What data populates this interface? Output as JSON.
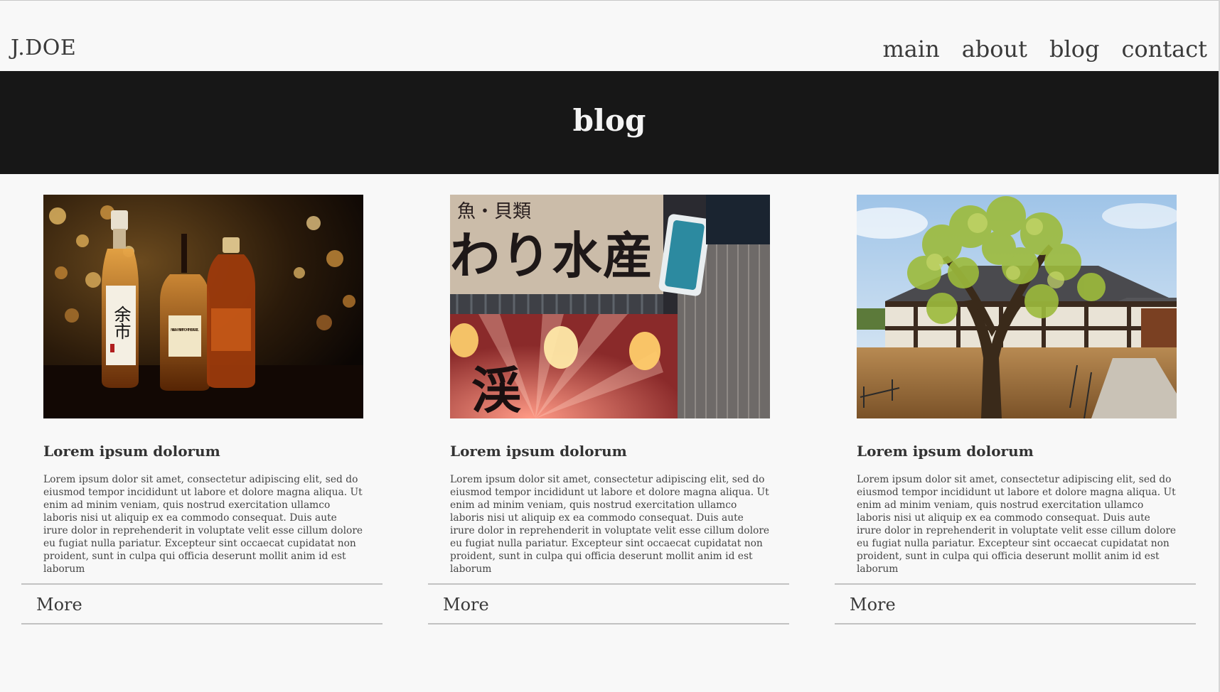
{
  "site": {
    "logo": "J.DOE"
  },
  "nav": {
    "items": [
      "main",
      "about",
      "blog",
      "contact"
    ]
  },
  "banner": {
    "title": "blog"
  },
  "posts": [
    {
      "title": "Lorem ipsum dolorum",
      "body": "Lorem ipsum dolor sit amet, consectetur adipiscing elit, sed do eiusmod tempor incididunt ut labore et dolore magna aliqua. Ut enim ad minim veniam, quis nostrud exercitation ullamco laboris nisi ut aliquip ex ea commodo consequat. Duis aute irure dolor in reprehenderit in voluptate velit esse cillum dolore eu fugiat nulla pariatur. Excepteur sint occaecat cupidatat non proident, sunt in culpa qui officia deserunt mollit anim id est laborum",
      "more_label": "More",
      "image": "whisky-bottles-photo",
      "image_text": [
        "余市",
        "NIKKA WHISKY FROM THE BARREL"
      ]
    },
    {
      "title": "Lorem ipsum dolorum",
      "body": "Lorem ipsum dolor sit amet, consectetur adipiscing elit, sed do eiusmod tempor incididunt ut labore et dolore magna aliqua. Ut enim ad minim veniam, quis nostrud exercitation ullamco laboris nisi ut aliquip ex ea commodo consequat. Duis aute irure dolor in reprehenderit in voluptate velit esse cillum dolore eu fugiat nulla pariatur. Excepteur sint occaecat cupidatat non proident, sunt in culpa qui officia deserunt mollit anim id est laborum",
      "more_label": "More",
      "image": "japanese-street-sign-photo",
      "image_text": [
        "魚・貝類",
        "わり水産",
        "渓"
      ]
    },
    {
      "title": "Lorem ipsum dolorum",
      "body": "Lorem ipsum dolor sit amet, consectetur adipiscing elit, sed do eiusmod tempor incididunt ut labore et dolore magna aliqua. Ut enim ad minim veniam, quis nostrud exercitation ullamco laboris nisi ut aliquip ex ea commodo consequat. Duis aute irure dolor in reprehenderit in voluptate velit esse cillum dolore eu fugiat nulla pariatur. Excepteur sint occaecat cupidatat non proident, sunt in culpa qui officia deserunt mollit anim id est laborum",
      "more_label": "More",
      "image": "temple-tree-photo"
    }
  ],
  "colors": {
    "background": "#f8f8f8",
    "banner": "#171717",
    "text": "#333333",
    "divider": "#c2c2c2"
  }
}
